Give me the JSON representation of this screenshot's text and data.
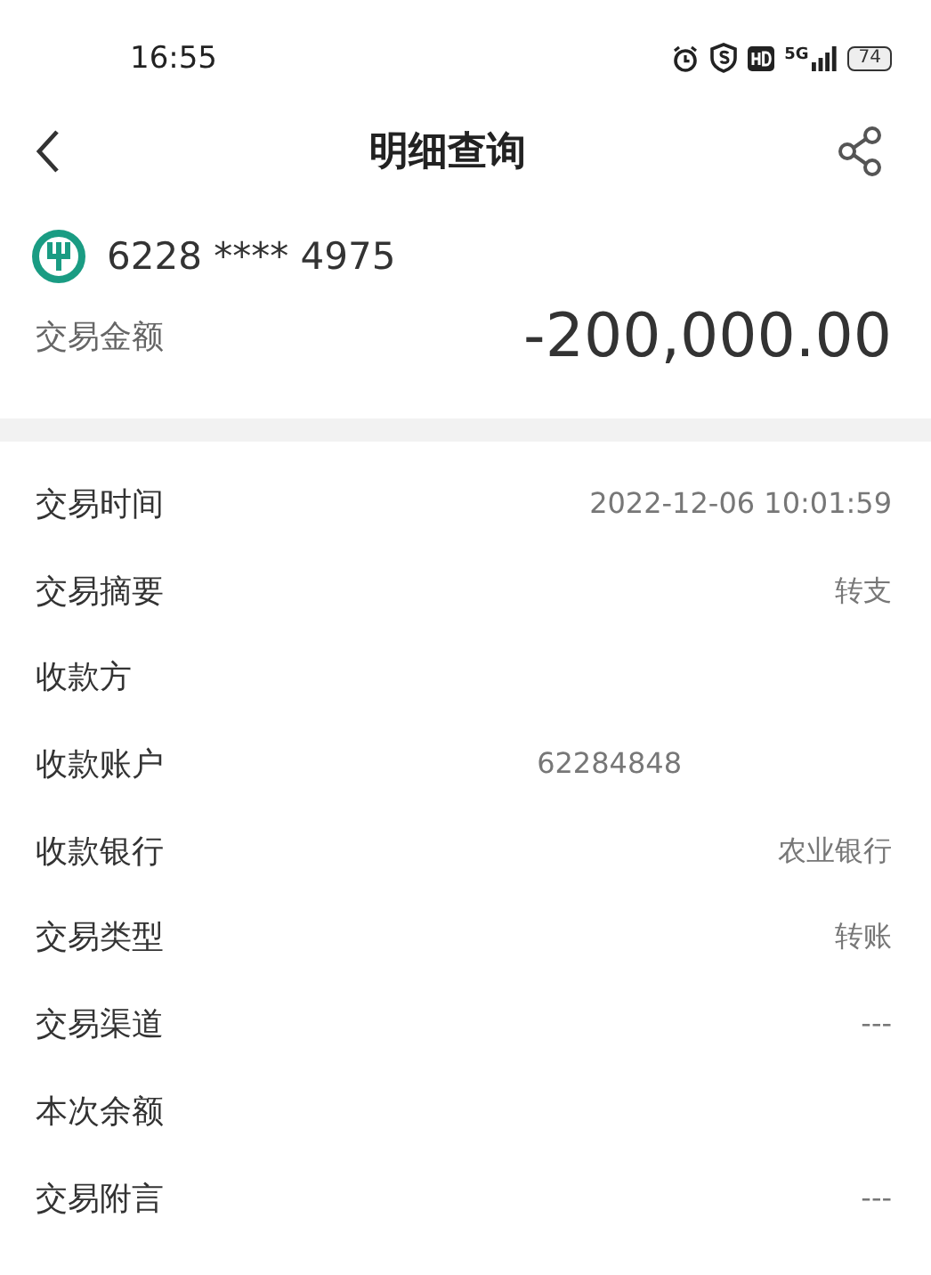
{
  "status_bar": {
    "time": "16:55",
    "network": "5G",
    "battery": "74"
  },
  "header": {
    "title": "明细查询"
  },
  "account": {
    "number": "6228 **** 4975"
  },
  "amount": {
    "label": "交易金额",
    "value": "-200,000.00"
  },
  "details": [
    {
      "label": "交易时间",
      "value": "2022-12-06 10:01:59",
      "kind": "plain"
    },
    {
      "label": "交易摘要",
      "value": "转支",
      "kind": "plain"
    },
    {
      "label": "收款方",
      "kind": "plain"
    },
    {
      "label": "收款账户",
      "value": "62284848",
      "kind": "masked"
    },
    {
      "label": "收款银行",
      "value": "农业银行",
      "kind": "plain"
    },
    {
      "label": "交易类型",
      "value": "转账",
      "kind": "plain"
    },
    {
      "label": "交易渠道",
      "value": "---",
      "kind": "plain"
    },
    {
      "label": "本次余额",
      "kind": "plain"
    },
    {
      "label": "交易附言",
      "value": "---",
      "kind": "plain"
    }
  ]
}
